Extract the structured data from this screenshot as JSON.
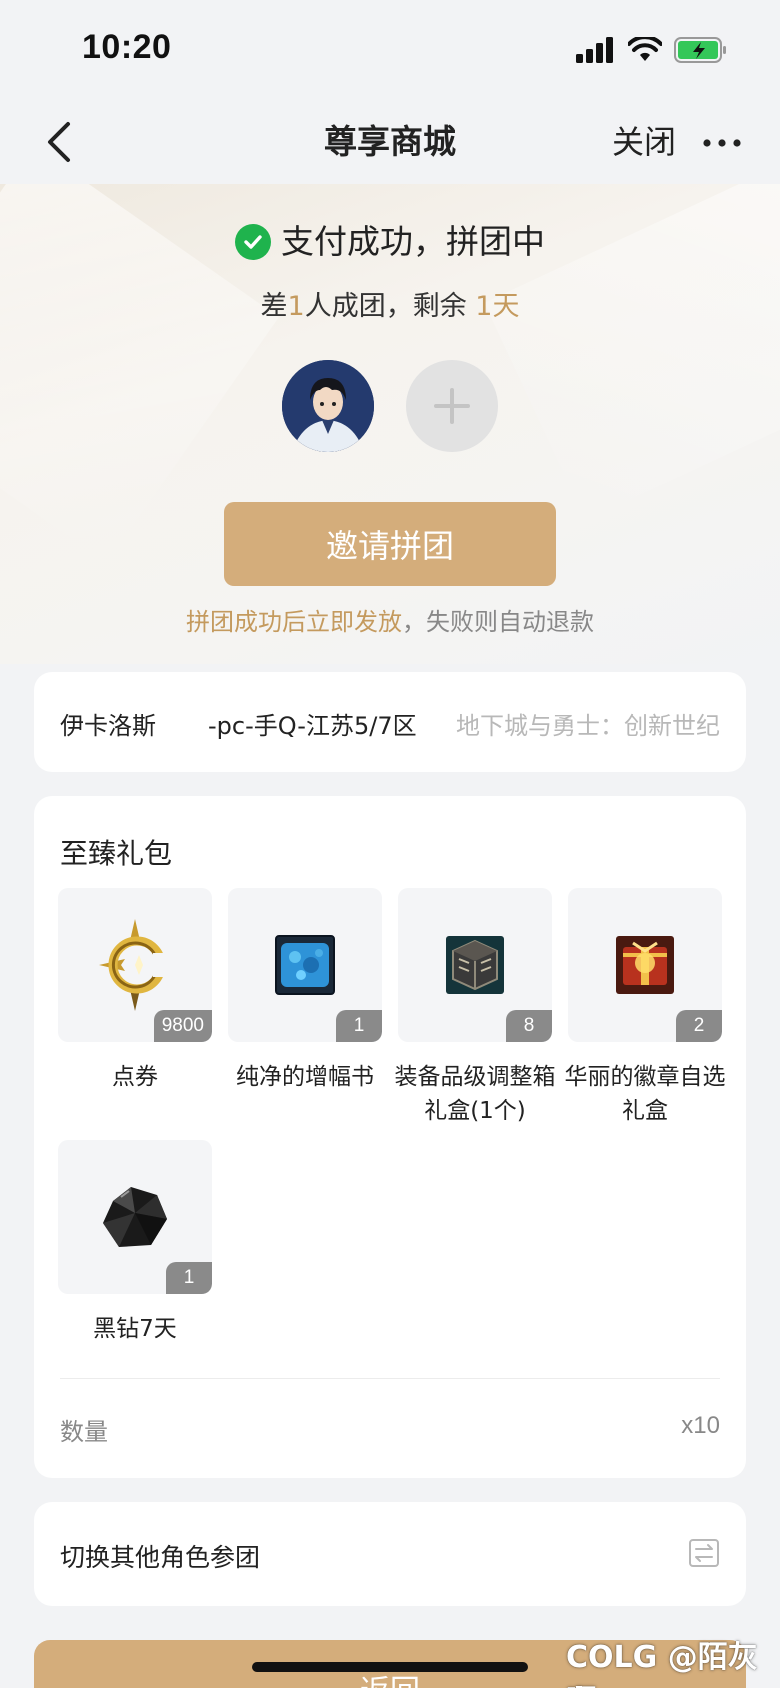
{
  "status_bar": {
    "time": "10:20"
  },
  "nav": {
    "title": "尊享商城",
    "close_label": "关闭"
  },
  "payment": {
    "title": "支付成功，拼团中",
    "remaining_prefix": "差",
    "remaining_count": "1",
    "remaining_middle": "人成团，剩余 ",
    "remaining_time": "1天",
    "invite_label": "邀请拼团",
    "note_highlight": "拼团成功后立即发放",
    "note_rest": "，失败则自动退款"
  },
  "server": {
    "role": "伊卡洛斯",
    "zone": "-pc-手Q-江苏5/7区",
    "game": "地下城与勇士：创新世纪"
  },
  "pack": {
    "title": "至臻礼包",
    "items": [
      {
        "name": "点券",
        "count": "9800",
        "icon": "coupon-icon"
      },
      {
        "name": "纯净的增幅书",
        "count": "1",
        "icon": "amplify-book-icon"
      },
      {
        "name": "装备品级调整箱礼盒(1个)",
        "count": "8",
        "icon": "grade-box-icon"
      },
      {
        "name": "华丽的徽章自选礼盒",
        "count": "2",
        "icon": "emblem-box-icon"
      },
      {
        "name": "黑钻7天",
        "count": "1",
        "icon": "black-diamond-icon"
      }
    ],
    "quantity_label": "数量",
    "quantity_value": "x10"
  },
  "switch_role": {
    "label": "切换其他角色参团"
  },
  "return_label": "返回",
  "watermark": "COLG @陌灰啊",
  "colors": {
    "accent": "#d4ad7b",
    "success": "#1fb34d"
  }
}
